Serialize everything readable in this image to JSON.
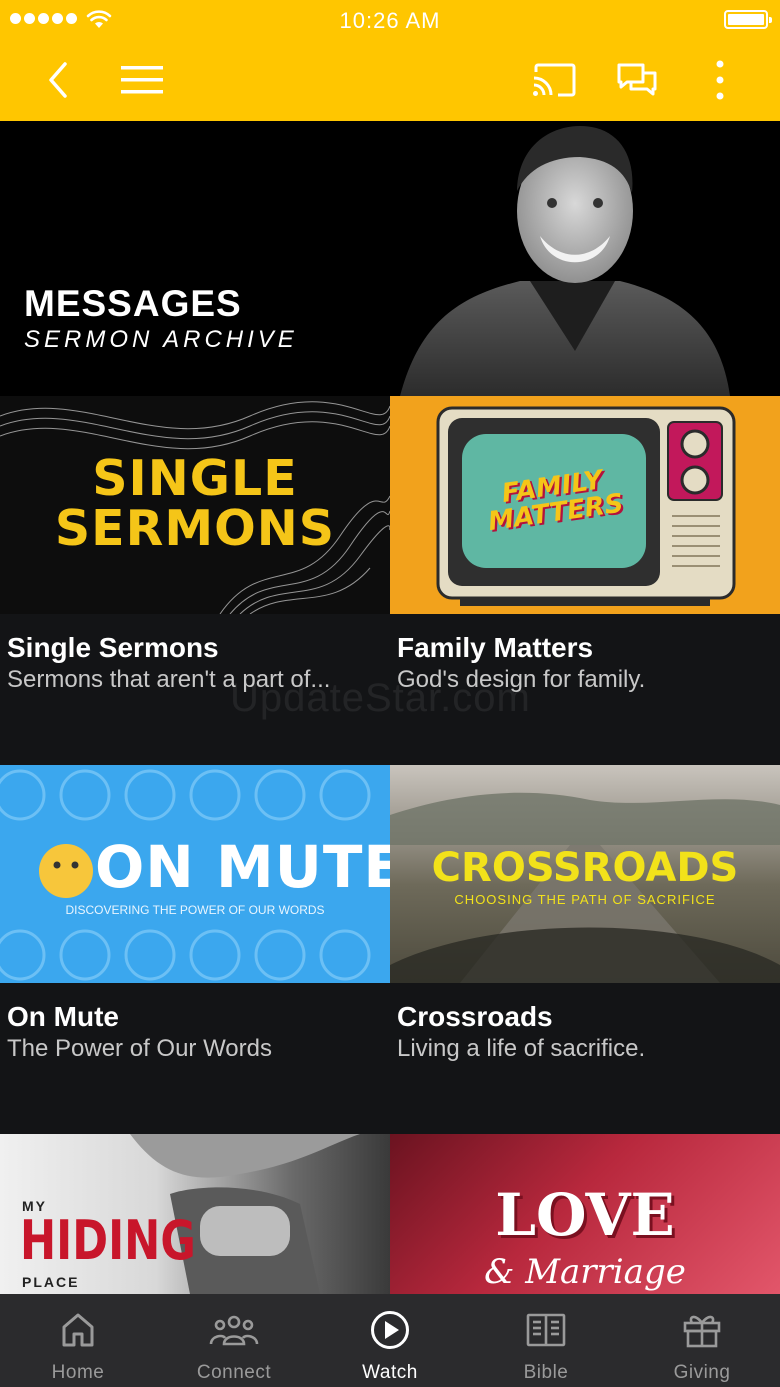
{
  "status_bar": {
    "time": "10:26 AM"
  },
  "hero": {
    "title": "MESSAGES",
    "subtitle": "SERMON ARCHIVE"
  },
  "series": [
    {
      "thumb_text": "SINGLE SERMONS",
      "title": "Single Sermons",
      "description": "Sermons that aren't a part of..."
    },
    {
      "thumb_text": "FAMILY MATTERS",
      "title": "Family Matters",
      "description": "God's design for family."
    },
    {
      "thumb_text": "ON MUTE",
      "thumb_subtext": "DISCOVERING THE POWER OF OUR WORDS",
      "title": "On Mute",
      "description": "The Power of Our Words"
    },
    {
      "thumb_text": "CROSSROADS",
      "thumb_subtext": "CHOOSING THE PATH OF SACRIFICE",
      "title": "Crossroads",
      "description": "Living a life of sacrifice."
    },
    {
      "thumb_text_top": "MY",
      "thumb_text": "HIDING",
      "thumb_text_bottom": "PLACE"
    },
    {
      "thumb_text": "LOVE",
      "thumb_subtext": "& Marriage"
    }
  ],
  "watermark": "UpdateStar.com",
  "tabs": [
    {
      "label": "Home",
      "icon": "home-icon",
      "active": false
    },
    {
      "label": "Connect",
      "icon": "people-icon",
      "active": false
    },
    {
      "label": "Watch",
      "icon": "play-circle-icon",
      "active": true
    },
    {
      "label": "Bible",
      "icon": "book-icon",
      "active": false
    },
    {
      "label": "Giving",
      "icon": "gift-icon",
      "active": false
    }
  ],
  "colors": {
    "accent": "#FFC600",
    "background": "#131416",
    "tabbar": "#2b2b2d"
  }
}
